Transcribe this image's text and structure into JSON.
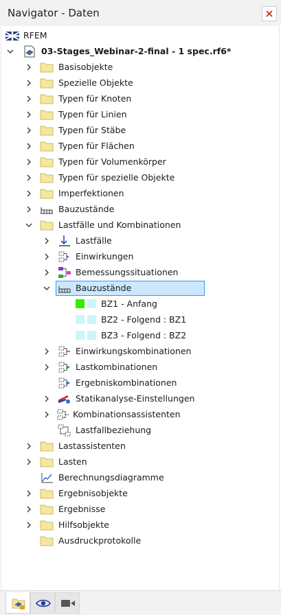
{
  "window": {
    "title": "Navigator - Daten"
  },
  "tree": {
    "root": "RFEM",
    "file": "03-Stages_Webinar-2-final - 1 spec.rf6*",
    "items": [
      "Basisobjekte",
      "Spezielle Objekte",
      "Typen für Knoten",
      "Typen für Linien",
      "Typen für Stäbe",
      "Typen für Flächen",
      "Typen für Volumenkörper",
      "Typen für spezielle Objekte",
      "Imperfektionen",
      "Bauzustände",
      "Lastfälle und Kombinationen",
      "Lastassistenten",
      "Lasten",
      "Berechnungsdiagramme",
      "Ergebnisobjekte",
      "Ergebnisse",
      "Hilfsobjekte",
      "Ausdruckprotokolle"
    ],
    "lastfaelle": [
      "Lastfälle",
      "Einwirkungen",
      "Bemessungssituationen",
      "Bauzustände",
      "Einwirkungskombinationen",
      "Lastkombinationen",
      "Ergebniskombinationen",
      "Statikanalyse-Einstellungen",
      "Kombinationsassistenten",
      "Lastfallbeziehung"
    ],
    "bauzustaende": [
      "BZ1 - Anfang",
      "BZ2 - Folgend : BZ1",
      "BZ3 - Folgend : BZ2"
    ]
  },
  "colors": {
    "selection": "#cce8ff",
    "selection_border": "#3399ff",
    "folder": "#f5e79e",
    "bz_active": "#33ee00",
    "bz_inactive": "#ccf5fb"
  },
  "icons": {
    "close": "close-icon",
    "tabs": [
      "data-navigator-icon",
      "eye-icon",
      "camera-icon"
    ]
  }
}
